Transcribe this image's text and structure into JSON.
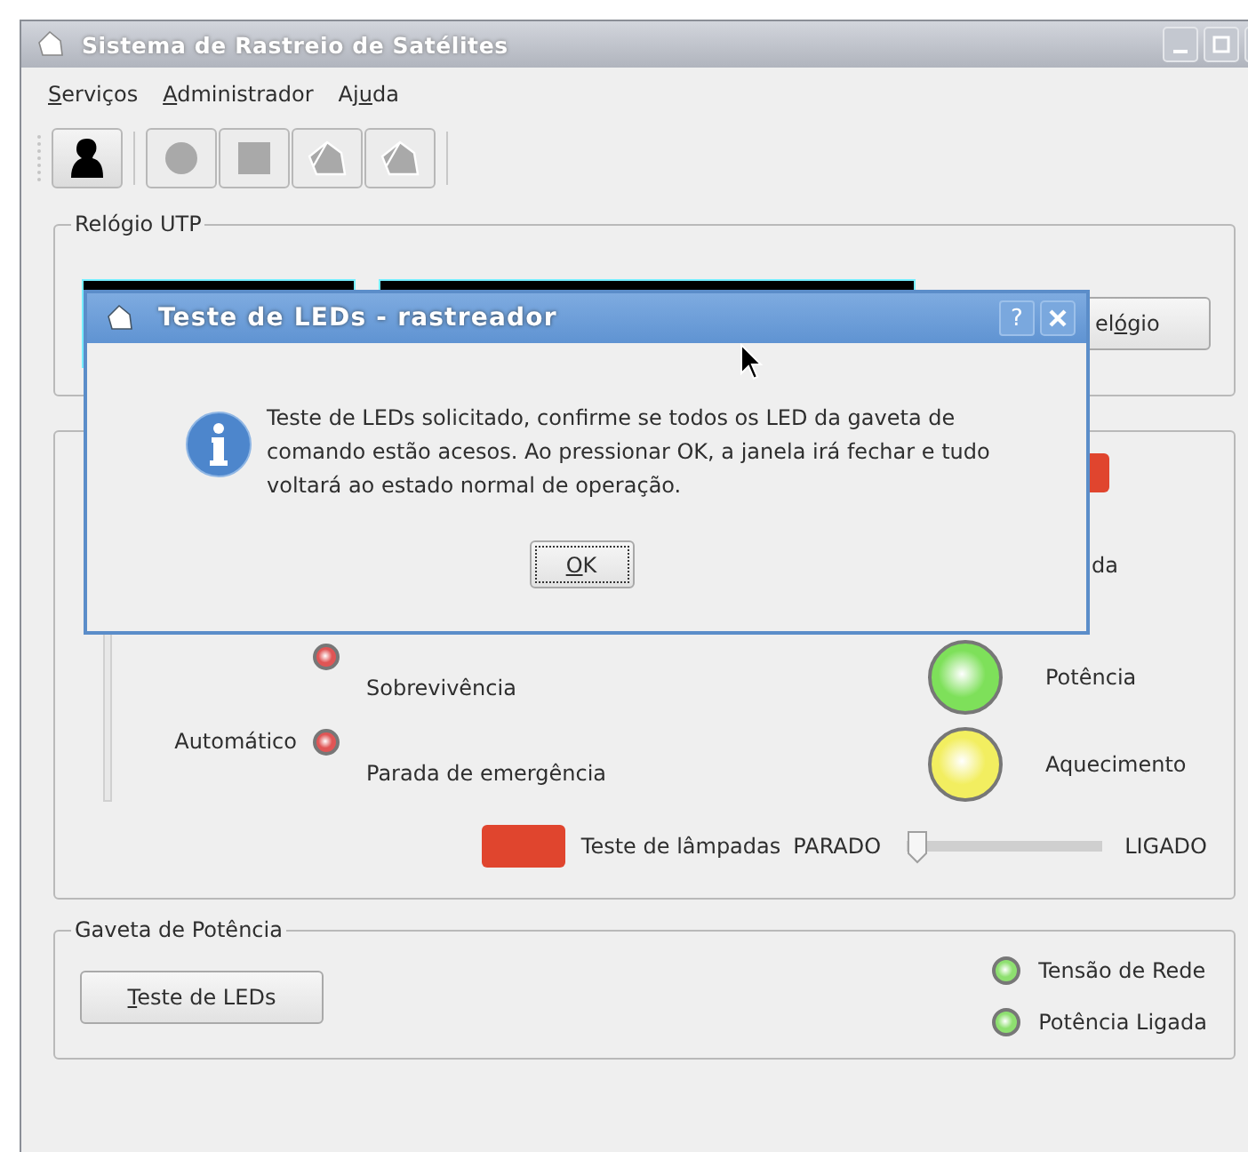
{
  "window": {
    "title": "Sistema de Rastreio de Satélites"
  },
  "menu": [
    {
      "key": "S",
      "after": "erviços"
    },
    {
      "key": "A",
      "after": "dministrador"
    },
    {
      "before": "Aj",
      "key": "u",
      "after": "da"
    }
  ],
  "toolbar": [
    {
      "kind": "person",
      "disabled": false
    },
    {
      "kind": "record",
      "disabled": true
    },
    {
      "kind": "stop",
      "disabled": true
    },
    {
      "kind": "dish",
      "disabled": true
    },
    {
      "kind": "dish",
      "disabled": true
    }
  ],
  "clock_group": {
    "title": "Relógio UTP",
    "button": {
      "before": "el",
      "key": "ó",
      "after": "gio"
    }
  },
  "status_group": {
    "top_indicator": {
      "color": "#e0452e"
    },
    "partial_label": "da",
    "mode_label": "Automático",
    "small_lamps": [
      {
        "label": "Sobrevivência",
        "color": "#e05555"
      },
      {
        "label": "Parada de emergência",
        "color": "#e05555"
      }
    ],
    "big_lamps": [
      {
        "label": "Potência",
        "color": "#7ee05a"
      },
      {
        "label": "Aquecimento",
        "color": "#f2ee60"
      }
    ],
    "lamp_test": {
      "color": "#e0452e",
      "label": "Teste de lâmpadas"
    },
    "switch": {
      "off_label": "PARADO",
      "on_label": "LIGADO",
      "level": 0
    }
  },
  "power_group": {
    "title": "Gaveta de Potência",
    "button": {
      "key": "T",
      "after": "este de LEDs"
    },
    "lamps": [
      {
        "label": "Tensão de Rede",
        "color": "#8ee070"
      },
      {
        "label": "Potência Ligada",
        "color": "#8ee070"
      }
    ]
  },
  "dialog": {
    "title": "Teste de LEDs - rastreador",
    "help": "?",
    "message": "Teste de LEDs solicitado, confirme se todos os LED da gaveta de comando estão acesos. Ao pressionar OK, a janela irá fechar e tudo voltará ao estado normal de operação.",
    "button": {
      "key": "O",
      "after": "K",
      "focused": true
    }
  }
}
